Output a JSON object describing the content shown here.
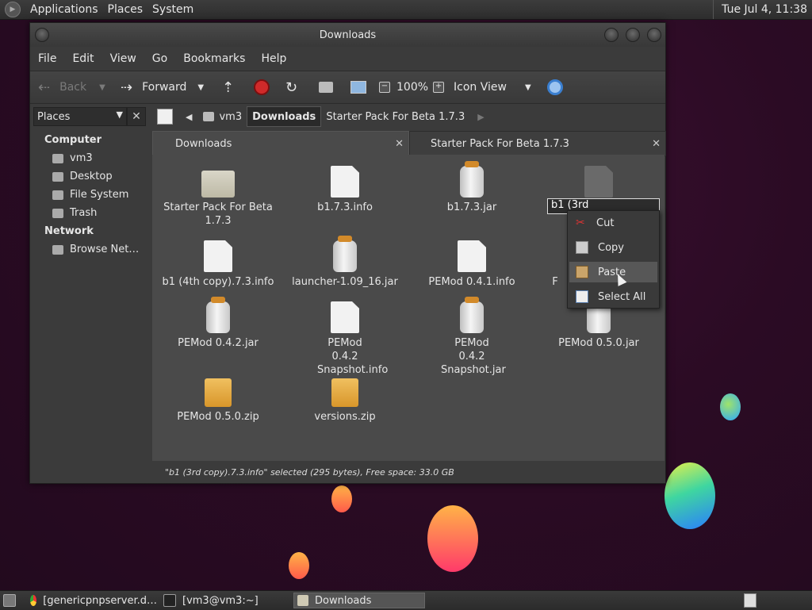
{
  "top_panel": {
    "menus": [
      "Applications",
      "Places",
      "System"
    ],
    "clock": "Tue Jul  4, 11:38"
  },
  "window": {
    "title": "Downloads",
    "menus": [
      "File",
      "Edit",
      "View",
      "Go",
      "Bookmarks",
      "Help"
    ],
    "toolbar": {
      "back_label": "Back",
      "forward_label": "Forward",
      "zoom_label": "100%",
      "view_mode": "Icon View"
    },
    "sidebar": {
      "header": "Places",
      "sections": [
        {
          "title": "Computer",
          "items": [
            "vm3",
            "Desktop",
            "File System",
            "Trash"
          ]
        },
        {
          "title": "Network",
          "items": [
            "Browse Net…"
          ]
        }
      ]
    },
    "location": {
      "crumbs": [
        "vm3",
        "Downloads",
        "Starter Pack For Beta 1.7.3"
      ],
      "active": "Downloads"
    },
    "tabs": [
      {
        "label": "Downloads"
      },
      {
        "label": "Starter Pack For Beta 1.7.3"
      }
    ],
    "files": [
      {
        "name": "Starter Pack For Beta 1.7.3",
        "type": "folder"
      },
      {
        "name": "b1.7.3.info",
        "type": "doc"
      },
      {
        "name": "b1.7.3.jar",
        "type": "jar"
      },
      {
        "name": "b1 (3rd copy).7.3.info",
        "type": "doc-selected",
        "rename_text": "b1 (3rd copy).7.3.info"
      },
      {
        "name": "b1 (4th copy).7.3.info",
        "type": "doc"
      },
      {
        "name": "launcher-1.09_16.jar",
        "type": "jar"
      },
      {
        "name": "PEMod 0.4.1.info",
        "type": "doc"
      },
      {
        "name": "F",
        "type": "hidden"
      },
      {
        "name": "PEMod 0.4.2.jar",
        "type": "jar"
      },
      {
        "name": "PEMod 0.4.2 Snapshot.info",
        "type": "doc"
      },
      {
        "name": "PEMod 0.4.2 Snapshot.jar",
        "type": "jar"
      },
      {
        "name": "PEMod 0.5.0.jar",
        "type": "jar"
      },
      {
        "name": "PEMod 0.5.0.zip",
        "type": "zip"
      },
      {
        "name": "versions.zip",
        "type": "zip"
      }
    ],
    "context_menu": {
      "items": [
        "Cut",
        "Copy",
        "Paste",
        "Select All"
      ],
      "hovered": "Paste"
    },
    "status": "\"b1 (3rd copy).7.3.info\" selected (295 bytes), Free space: 33.0 GB"
  },
  "bottom_panel": {
    "tasks": [
      "[genericpnpserver.d…",
      "[vm3@vm3:~]",
      "Downloads"
    ],
    "active_task": "Downloads"
  },
  "colors": {
    "desktop_bg": "#2b0b24",
    "window_bg": "#3b3b3b",
    "icon_area_bg": "#4a4a4a",
    "context_hover": "#575757"
  }
}
